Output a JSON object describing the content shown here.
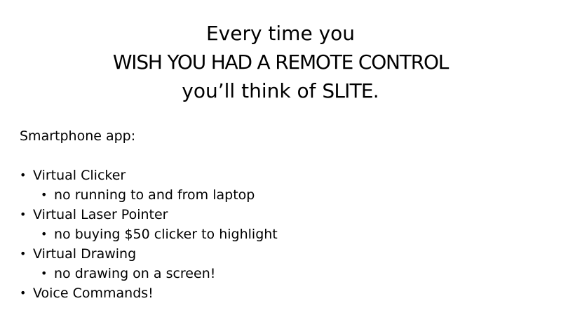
{
  "title": {
    "line1": "Every time you",
    "line2": "WISH YOU HAD A REMOTE CONTROL",
    "line3_pre": "you’ll think of ",
    "line3_brand": "SLITE",
    "line3_post": "."
  },
  "content": {
    "intro": "Smartphone app:",
    "bullet_glyph": "•",
    "items": [
      {
        "level": 1,
        "text": "Virtual Clicker"
      },
      {
        "level": 2,
        "text": "no running to and from laptop"
      },
      {
        "level": 1,
        "text": "Virtual Laser Pointer"
      },
      {
        "level": 2,
        "text": "no buying $50 clicker to highlight"
      },
      {
        "level": 1,
        "text": "Virtual Drawing"
      },
      {
        "level": 2,
        "text": "no drawing on a screen!"
      },
      {
        "level": 1,
        "text": "Voice Commands!"
      }
    ]
  }
}
